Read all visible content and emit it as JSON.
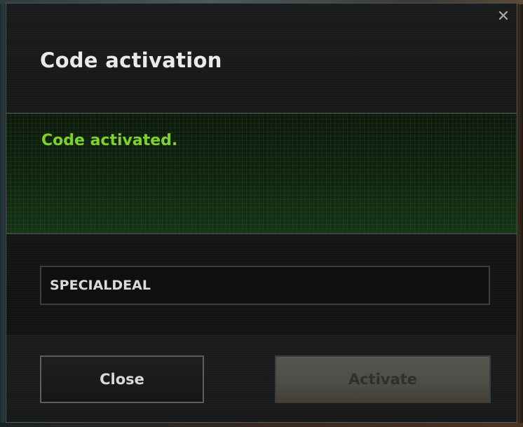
{
  "dialog": {
    "title": "Code activation",
    "close_icon": "close-icon",
    "status_message": "Code activated.",
    "status_color": "#7fd22a",
    "code_input": {
      "value": "SPECIALDEAL",
      "placeholder": ""
    },
    "buttons": {
      "close_label": "Close",
      "activate_label": "Activate"
    }
  }
}
